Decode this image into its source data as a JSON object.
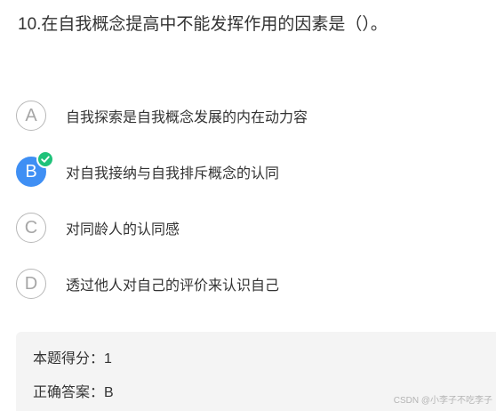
{
  "question": {
    "title": "10.在自我概念提高中不能发挥作用的因素是（）。"
  },
  "options": [
    {
      "letter": "A",
      "text": "自我探索是自我概念发展的内在动力容",
      "selected": false
    },
    {
      "letter": "B",
      "text": "对自我接纳与自我排斥概念的认同",
      "selected": true
    },
    {
      "letter": "C",
      "text": "对同龄人的认同感",
      "selected": false
    },
    {
      "letter": "D",
      "text": "透过他人对自己的评价来认识自己",
      "selected": false
    }
  ],
  "result": {
    "score_label": "本题得分：",
    "score_value": "1",
    "answer_label": "正确答案：",
    "answer_value": "B"
  },
  "watermark": "CSDN @小李子不吃李子",
  "colors": {
    "selected": "#3f8ff4",
    "check_badge": "#1fc27a",
    "panel_bg": "#f4f4f4"
  },
  "icons": {
    "check": "check-icon"
  }
}
